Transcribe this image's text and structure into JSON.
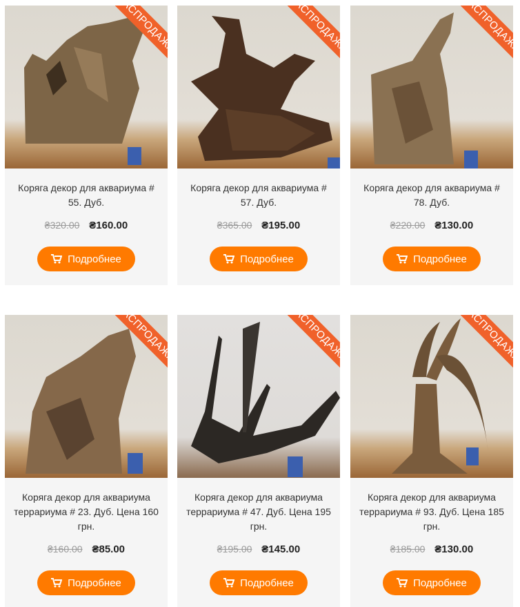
{
  "products": [
    {
      "badge": "РАСПРОДАЖА",
      "title": "Коряга декор для аквариума # 55. Дуб.",
      "old_price": "₴320.00",
      "new_price": "₴160.00",
      "button": "Подробнее"
    },
    {
      "badge": "РАСПРОДАЖА",
      "title": "Коряга декор для аквариума # 57. Дуб.",
      "old_price": "₴365.00",
      "new_price": "₴195.00",
      "button": "Подробнее"
    },
    {
      "badge": "РАСПРОДАЖА",
      "title": "Коряга декор для аквариума # 78. Дуб.",
      "old_price": "₴220.00",
      "new_price": "₴130.00",
      "button": "Подробнее"
    },
    {
      "badge": "РАСПРОДАЖА",
      "title": "Коряга декор для аквариума террариума # 23. Дуб. Цена 160 грн.",
      "old_price": "₴160.00",
      "new_price": "₴85.00",
      "button": "Подробнее"
    },
    {
      "badge": "РАСПРОДАЖА",
      "title": "Коряга декор для аквариума террариума # 47. Дуб. Цена 195 грн.",
      "old_price": "₴195.00",
      "new_price": "₴145.00",
      "button": "Подробнее"
    },
    {
      "badge": "РАСПРОДАЖА",
      "title": "Коряга декор для аквариума террариума # 93. Дуб. Цена 185 грн.",
      "old_price": "₴185.00",
      "new_price": "₴130.00",
      "button": "Подробнее"
    }
  ],
  "colors": {
    "accent": "#ff7a00",
    "badge": "#f0612a"
  },
  "icons": {
    "button_icon": "cart-icon"
  }
}
